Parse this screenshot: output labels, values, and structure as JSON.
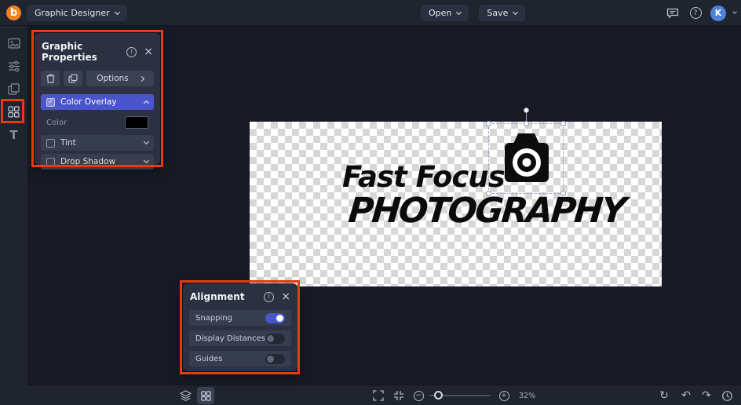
{
  "topbar": {
    "logo_letter": "b",
    "app_menu_label": "Graphic Designer",
    "open_label": "Open",
    "save_label": "Save",
    "avatar_initial": "K"
  },
  "properties_panel": {
    "title": "Graphic Properties",
    "options_label": "Options",
    "color_overlay": {
      "label": "Color Overlay",
      "checked": true
    },
    "color_label": "Color",
    "color_value": "#000000",
    "tint": {
      "label": "Tint",
      "checked": false
    },
    "drop_shadow": {
      "label": "Drop Shadow",
      "checked": false
    }
  },
  "alignment_panel": {
    "title": "Alignment",
    "toggles": [
      {
        "label": "Snapping",
        "on": true
      },
      {
        "label": "Display Distances",
        "on": false
      },
      {
        "label": "Guides",
        "on": false
      }
    ]
  },
  "canvas": {
    "logo_text_line1": "Fast Focus",
    "logo_text_line2": "PHOTOGRAPHY"
  },
  "statusbar": {
    "zoom_percent": "32%"
  },
  "icons": {
    "help": "?",
    "info": "i",
    "close": "×",
    "check": "✓",
    "minus": "−",
    "plus": "+",
    "undo": "↶",
    "redo": "↷",
    "reset": "↻",
    "text_tool": "T"
  },
  "colors": {
    "accent": "#4a55cb",
    "annotation_red": "#e8390f",
    "avatar_blue": "#4f81d8",
    "logo_orange": "#f08121",
    "swatch_black": "#000000"
  }
}
